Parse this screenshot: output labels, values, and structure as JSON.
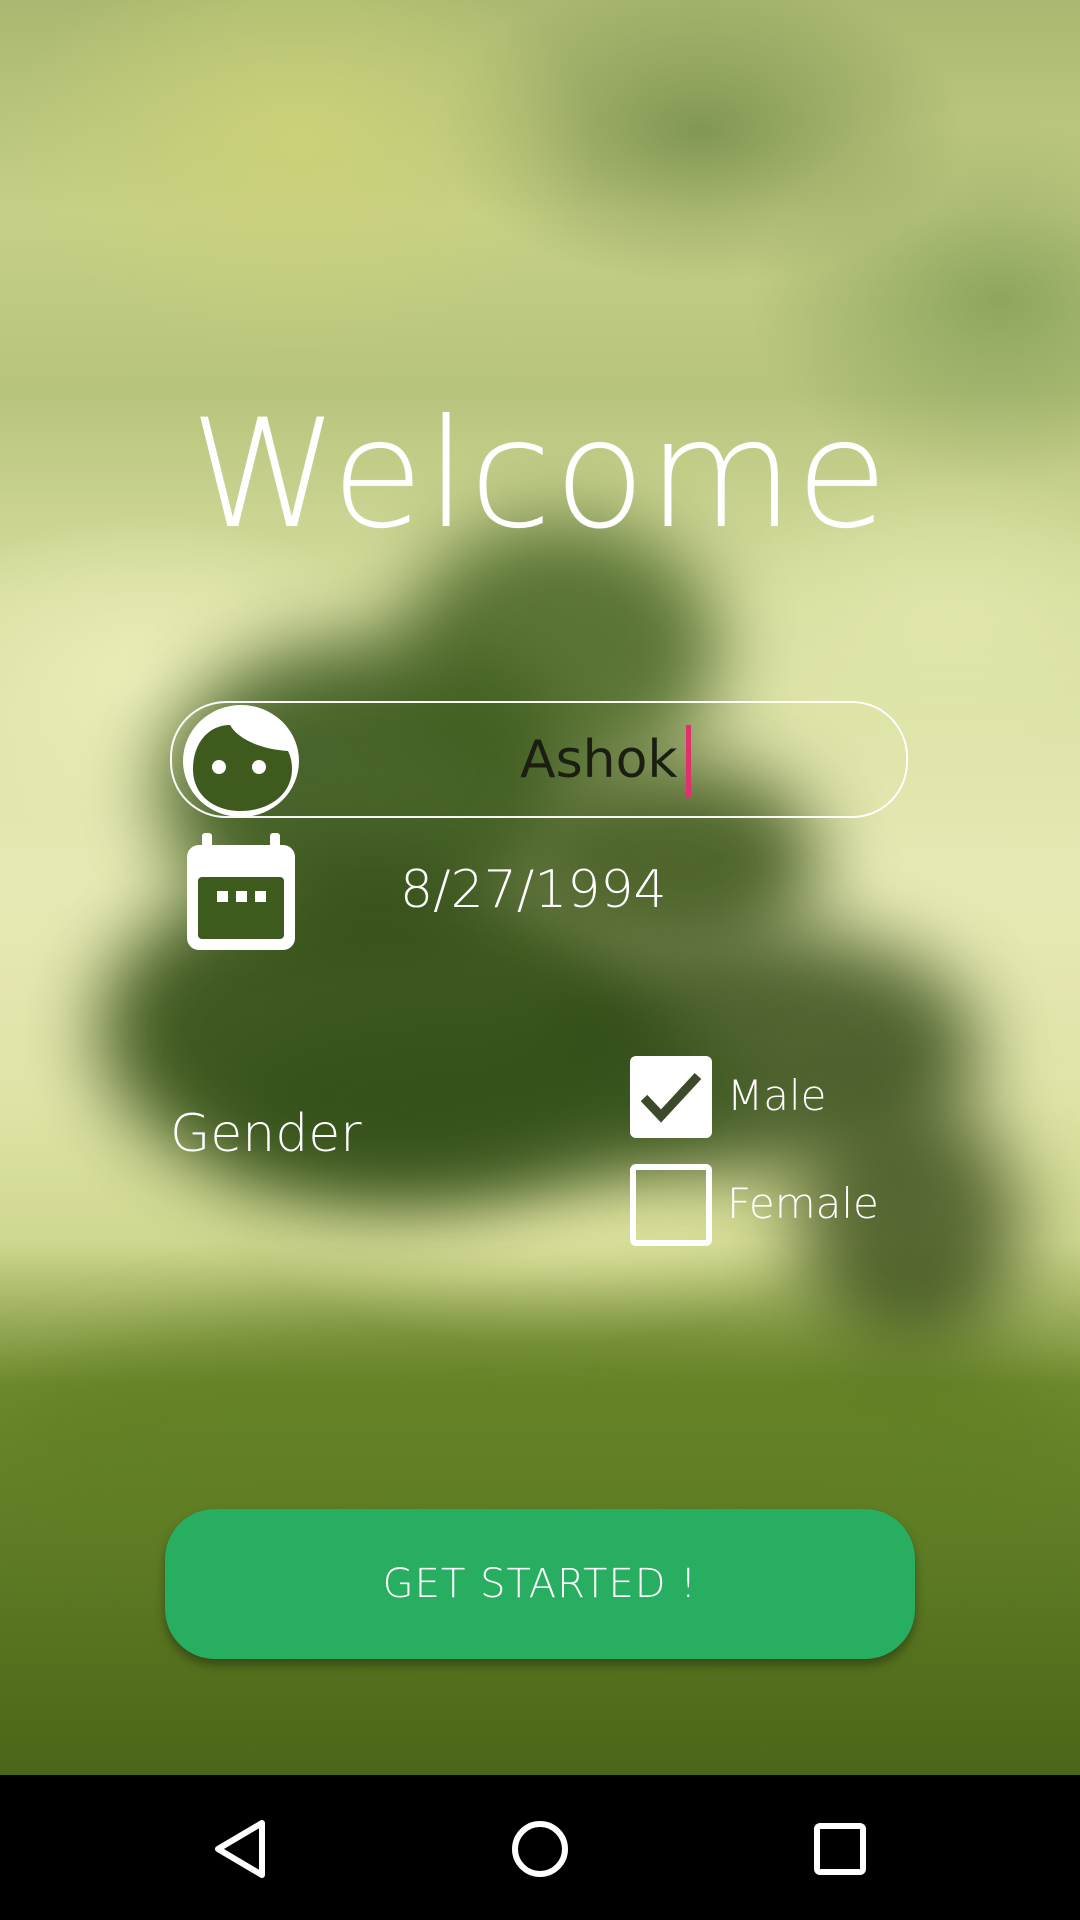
{
  "app": {
    "title": "Welcome"
  },
  "form": {
    "name": {
      "value": "Ashok",
      "icon": "face-icon"
    },
    "dob": {
      "value": "8/27/1994",
      "icon": "calendar-icon"
    },
    "gender": {
      "label": "Gender",
      "options": [
        {
          "label": "Male",
          "checked": true
        },
        {
          "label": "Female",
          "checked": false
        }
      ]
    },
    "submit_label": "GET STARTED !"
  },
  "colors": {
    "accent": "#27ae60",
    "caret": "#e1306c",
    "text_light": "#ffffff",
    "input_text": "#1b1f12"
  },
  "system_nav": {
    "icons": [
      "back-icon",
      "home-icon",
      "recents-icon"
    ]
  }
}
